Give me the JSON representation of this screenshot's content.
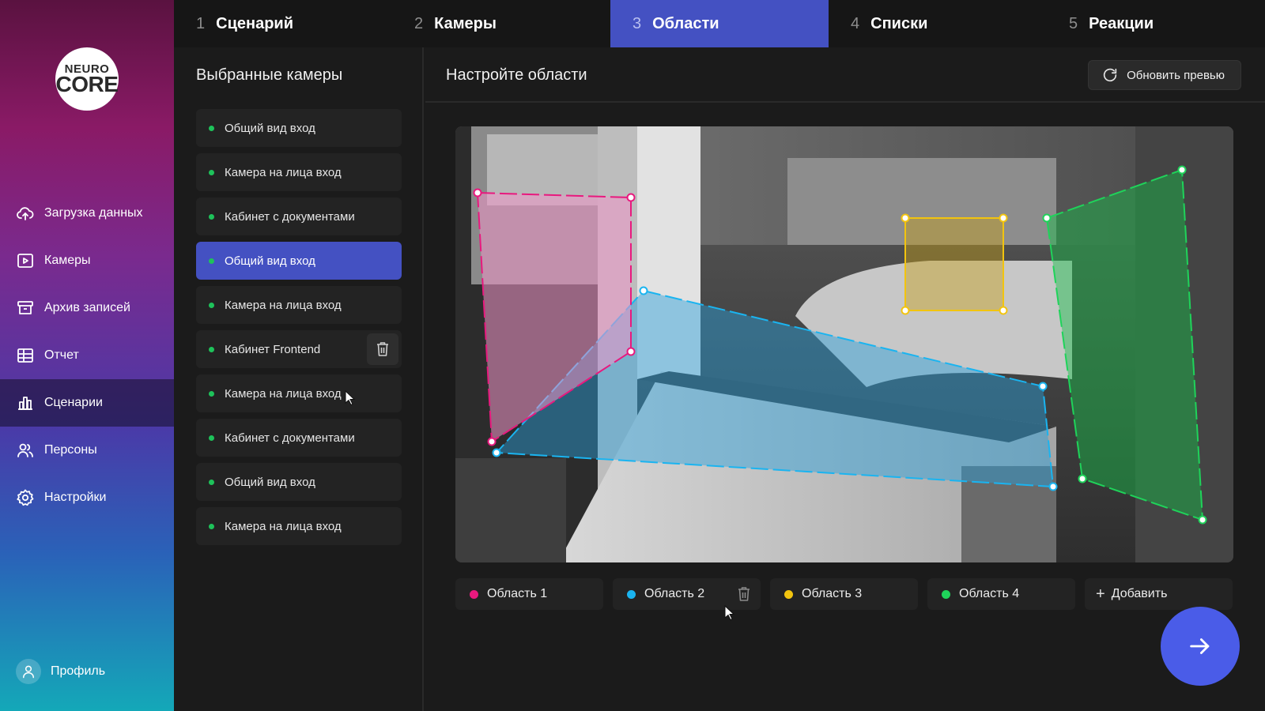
{
  "brand": {
    "logo_line1": "NEURO",
    "logo_line2": "CORE"
  },
  "sidebar": {
    "items": [
      {
        "label": "Загрузка данных",
        "icon": "cloud-upload-icon"
      },
      {
        "label": "Камеры",
        "icon": "video-icon"
      },
      {
        "label": "Архив записей",
        "icon": "archive-icon"
      },
      {
        "label": "Отчет",
        "icon": "table-icon"
      },
      {
        "label": "Сценарии",
        "icon": "bar-chart-icon",
        "active": true
      },
      {
        "label": "Персоны",
        "icon": "users-icon"
      },
      {
        "label": "Настройки",
        "icon": "gear-icon"
      }
    ],
    "profile_label": "Профиль"
  },
  "tabs": [
    {
      "num": "1",
      "label": "Сценарий"
    },
    {
      "num": "2",
      "label": "Камеры"
    },
    {
      "num": "3",
      "label": "Области",
      "active": true
    },
    {
      "num": "4",
      "label": "Списки"
    },
    {
      "num": "5",
      "label": "Реакции"
    }
  ],
  "cameras": {
    "title": "Выбранные камеры",
    "items": [
      "Общий вид вход",
      "Камера на лица вход",
      "Кабинет с документами",
      "Общий вид вход",
      "Камера на лица вход",
      "Кабинет Frontend",
      "Камера на лица вход",
      "Кабинет с документами",
      "Общий вид вход",
      "Камера на лица вход"
    ],
    "selected_index": 3,
    "hover_index": 5
  },
  "main": {
    "title": "Настройте области",
    "refresh_label": "Обновить превью"
  },
  "areas": {
    "items": [
      {
        "label": "Область 1",
        "color": "#e8197e"
      },
      {
        "label": "Область 2",
        "color": "#1ab4f0"
      },
      {
        "label": "Область 3",
        "color": "#f2c40f"
      },
      {
        "label": "Область 4",
        "color": "#1fd35a"
      }
    ],
    "add_label": "Добавить"
  },
  "colors": {
    "accent": "#4451c2",
    "next_button": "#4a5ce8",
    "online_dot": "#1ec25a"
  }
}
